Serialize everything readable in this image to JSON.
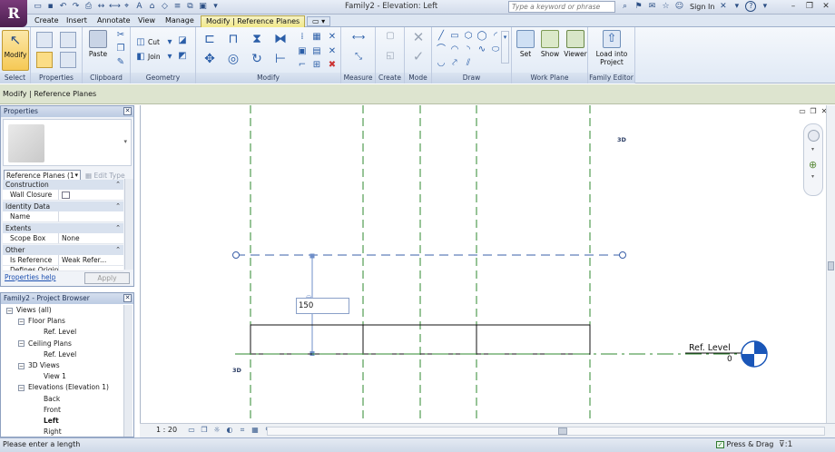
{
  "window": {
    "title": "Family2 - Elevation: Left",
    "search_placeholder": "Type a keyword or phrase",
    "sign_in": "Sign In"
  },
  "ribbon_tabs": [
    {
      "label": "Create"
    },
    {
      "label": "Insert"
    },
    {
      "label": "Annotate"
    },
    {
      "label": "View"
    },
    {
      "label": "Manage"
    },
    {
      "label": "Modify | Reference Planes"
    }
  ],
  "ribbon": {
    "select": {
      "modify_label": "Modify",
      "panel": "Select"
    },
    "properties_panel": "Properties",
    "clipboard": {
      "paste_label": "Paste",
      "panel": "Clipboard"
    },
    "geometry": {
      "cut_label": "Cut",
      "join_label": "Join",
      "panel": "Geometry"
    },
    "modify_panel": "Modify",
    "measure_panel": "Measure",
    "create_panel": "Create",
    "mode_panel": "Mode",
    "draw_panel": "Draw",
    "work_plane": {
      "set_label": "Set",
      "show_label": "Show",
      "viewer_label": "Viewer",
      "panel": "Work Plane"
    },
    "family_editor": {
      "load_label_1": "Load into",
      "load_label_2": "Project",
      "panel": "Family Editor"
    }
  },
  "options_bar": {
    "text": "Modify | Reference Planes"
  },
  "properties": {
    "title": "Properties",
    "type_selector": "Reference Planes (1",
    "edit_type": "Edit Type",
    "groups": [
      {
        "name": "Construction",
        "rows": [
          {
            "key": "Wall Closure",
            "value": ""
          }
        ]
      },
      {
        "name": "Identity Data",
        "rows": [
          {
            "key": "Name",
            "value": ""
          }
        ]
      },
      {
        "name": "Extents",
        "rows": [
          {
            "key": "Scope Box",
            "value": "None"
          }
        ]
      },
      {
        "name": "Other",
        "rows": [
          {
            "key": "Is Reference",
            "value": "Weak Refer..."
          },
          {
            "key": "Defines Origin",
            "value": ""
          }
        ]
      }
    ],
    "help_link": "Properties help",
    "apply": "Apply"
  },
  "browser": {
    "title": "Family2 - Project Browser",
    "items": [
      {
        "label": "Views (all)",
        "level": 0,
        "toggle": "−"
      },
      {
        "label": "Floor Plans",
        "level": 1,
        "toggle": "−"
      },
      {
        "label": "Ref. Level",
        "level": 2,
        "toggle": ""
      },
      {
        "label": "Ceiling Plans",
        "level": 1,
        "toggle": "−"
      },
      {
        "label": "Ref. Level",
        "level": 2,
        "toggle": ""
      },
      {
        "label": "3D Views",
        "level": 1,
        "toggle": "−"
      },
      {
        "label": "View 1",
        "level": 2,
        "toggle": ""
      },
      {
        "label": "Elevations (Elevation 1)",
        "level": 1,
        "toggle": "−"
      },
      {
        "label": "Back",
        "level": 2,
        "toggle": ""
      },
      {
        "label": "Front",
        "level": 2,
        "toggle": ""
      },
      {
        "label": "Left",
        "level": 2,
        "toggle": "",
        "bold": true
      },
      {
        "label": "Right",
        "level": 2,
        "toggle": ""
      }
    ]
  },
  "canvas": {
    "label_3d_top": "3D",
    "label_3d_bottom": "3D",
    "dimension_input": "150",
    "level_name": "Ref. Level",
    "level_value": "0",
    "ref_plane_color": "#2f8a2f",
    "level_marker_color": "#1a56b8"
  },
  "view_bar": {
    "scale": "1 : 20"
  },
  "status": {
    "text": "Please enter a length",
    "press_drag": "Press & Drag",
    "filter_count": ":1"
  }
}
